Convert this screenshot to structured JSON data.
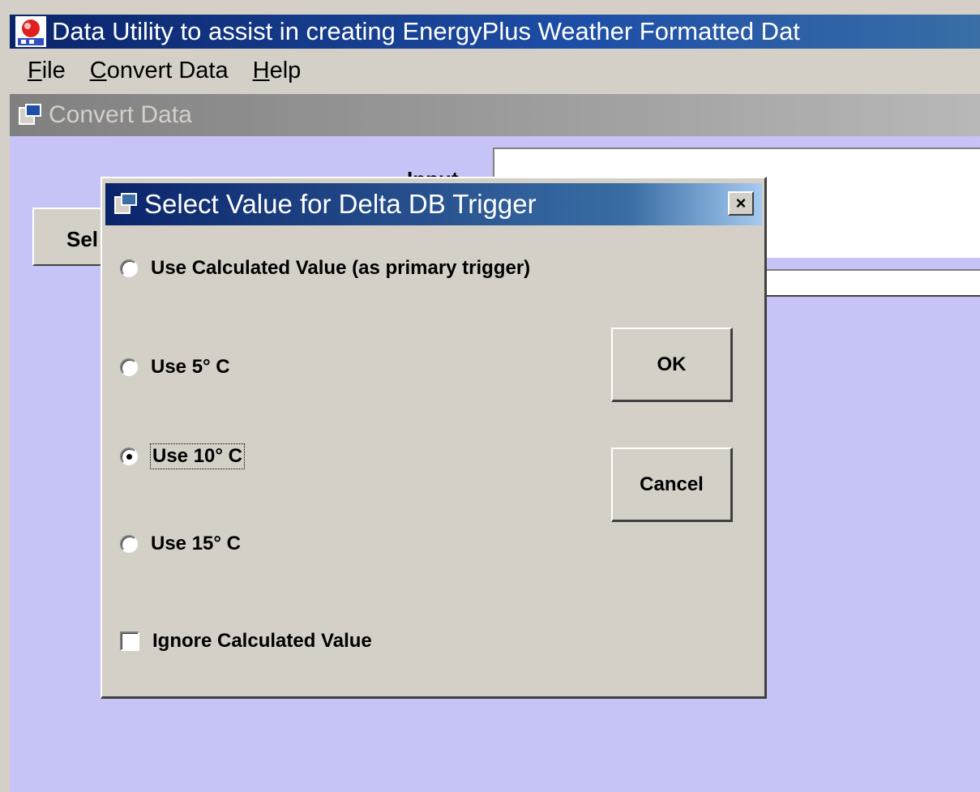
{
  "app": {
    "title": "Data Utility to assist in creating EnergyPlus Weather Formatted Dat",
    "icon": "app-icon"
  },
  "menu": {
    "items": [
      "File",
      "Convert Data",
      "Help"
    ]
  },
  "child_window": {
    "title": "Convert Data",
    "input_label": "Input",
    "select_button_label": "Sel"
  },
  "dialog": {
    "title": "Select Value for Delta DB Trigger",
    "close_label": "×",
    "options": [
      {
        "label": "Use Calculated Value (as primary trigger)",
        "checked": false
      },
      {
        "label": "Use 5° C",
        "checked": false
      },
      {
        "label": "Use 10° C",
        "checked": true
      },
      {
        "label": "Use 15° C",
        "checked": false
      }
    ],
    "ignore_checkbox": {
      "label": "Ignore Calculated Value",
      "checked": false
    },
    "ok_label": "OK",
    "cancel_label": "Cancel"
  },
  "colors": {
    "title_active": "#0a246a",
    "title_inactive": "#808080",
    "face": "#d4d0c8",
    "mdi_background": "#c6c3f6"
  }
}
